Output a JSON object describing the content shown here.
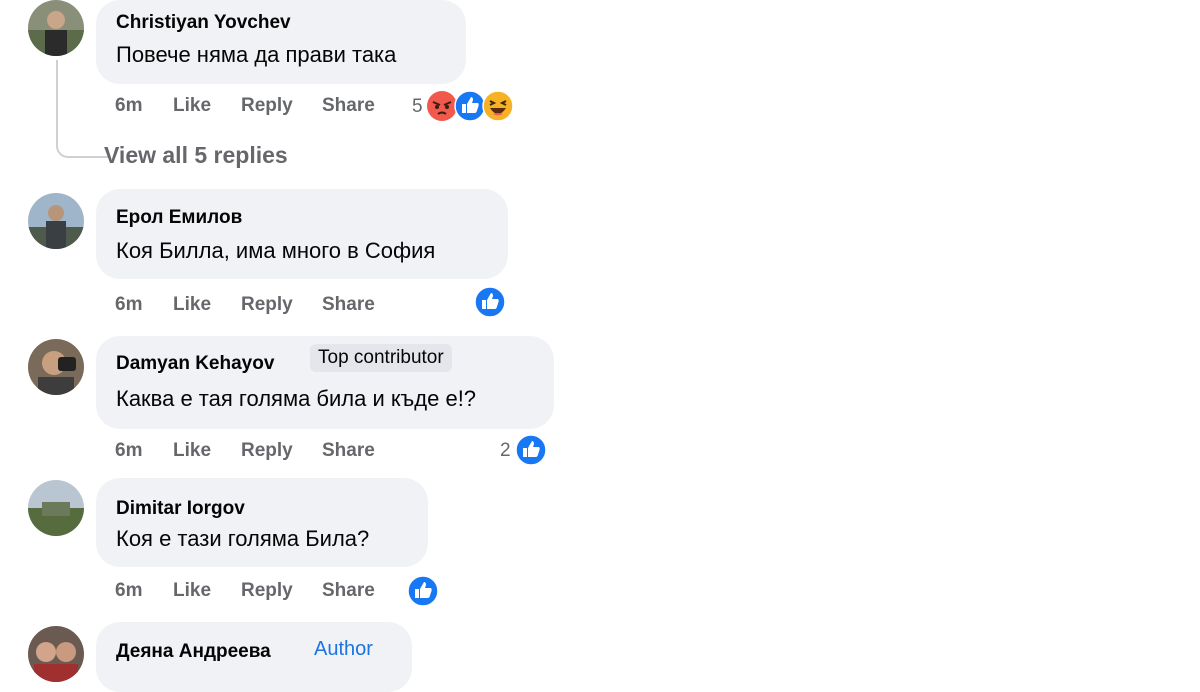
{
  "comments": [
    {
      "author": "Christiyan Yovchev",
      "text": "Повече няма да прави така",
      "time": "6m",
      "like": "Like",
      "reply": "Reply",
      "share": "Share",
      "reaction_count": "5",
      "reactions": [
        "angry-icon",
        "like-icon",
        "haha-icon"
      ]
    },
    {
      "author": "Ерол Емилов",
      "text": "Коя Билла, има много в София",
      "time": "6m",
      "like": "Like",
      "reply": "Reply",
      "share": "Share",
      "reaction_count": "",
      "reactions": [
        "like-icon"
      ]
    },
    {
      "author": "Damyan Kehayov",
      "badge": "Top contributor",
      "text": "Каква е тая голяма била и къде е!?",
      "time": "6m",
      "like": "Like",
      "reply": "Reply",
      "share": "Share",
      "reaction_count": "2",
      "reactions": [
        "like-icon"
      ]
    },
    {
      "author": "Dimitar Iorgov",
      "text": "Коя е тази голяма Била?",
      "time": "6m",
      "like": "Like",
      "reply": "Reply",
      "share": "Share",
      "reaction_count": "",
      "reactions": [
        "like-icon"
      ]
    },
    {
      "author": "Деяна Андреева",
      "badge": "Author",
      "text": "",
      "time": "",
      "reactions": []
    }
  ],
  "view_replies": "View all 5 replies",
  "colors": {
    "bubble": "#f0f2f5",
    "meta": "#65676b",
    "like_blue": "#1877f2",
    "author_blue": "#1b74e4",
    "angry": "#f0594b",
    "haha": "#f7b125"
  }
}
